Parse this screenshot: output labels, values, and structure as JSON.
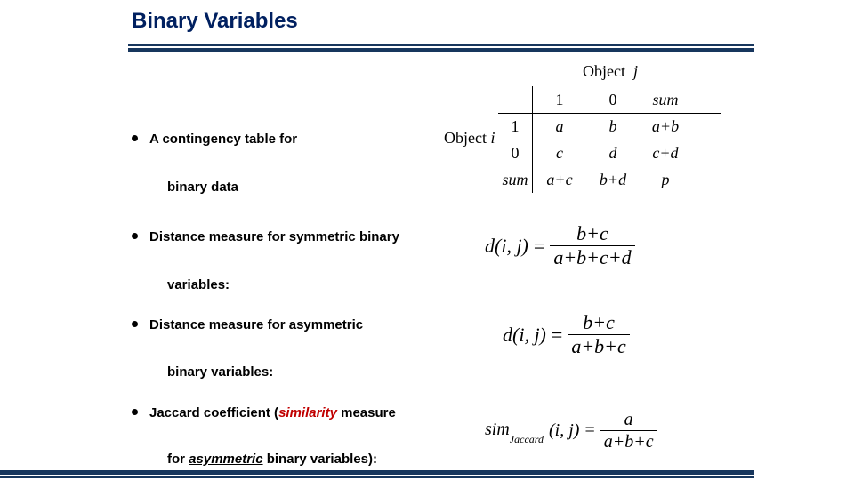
{
  "title": "Binary Variables",
  "labels": {
    "object_j": "Object",
    "object_j_var": "j",
    "object_i": "Object",
    "object_i_var": "i"
  },
  "contingency": {
    "col1": "1",
    "col0": "0",
    "colsum": "sum",
    "row1_stub": "1",
    "row0_stub": "0",
    "rowsum_stub": "sum",
    "r1c1": "a",
    "r1c0": "b",
    "r1sum": "a+b",
    "r0c1": "c",
    "r0c0": "d",
    "r0sum": "c+d",
    "sumc1": "a+c",
    "sumc0": "b+d",
    "total": "p"
  },
  "bullets": {
    "b1_line1": "A contingency table for",
    "b1_line2": "binary data",
    "b2_line1": "Distance measure for symmetric binary",
    "b2_line2": "variables:",
    "b3_line1": "Distance measure for asymmetric",
    "b3_line2": "binary variables:",
    "b4_line1_pre": "Jaccard coefficient (",
    "b4_line1_sim": "similarity",
    "b4_line1_post": " measure",
    "b4_line2_pre": "for ",
    "b4_line2_uline": "asymmetric",
    "b4_line2_post": " binary variables):"
  },
  "formulas": {
    "dij": "d(i, j)",
    "eq": "=",
    "sym_num": "b+c",
    "sym_den": "a+b+c+d",
    "asym_num": "b+c",
    "asym_den": "a+b+c",
    "sim_name": "sim",
    "sim_sub": "Jaccard",
    "sim_args": "(i, j)",
    "sim_num": "a",
    "sim_den": "a+b+c"
  }
}
